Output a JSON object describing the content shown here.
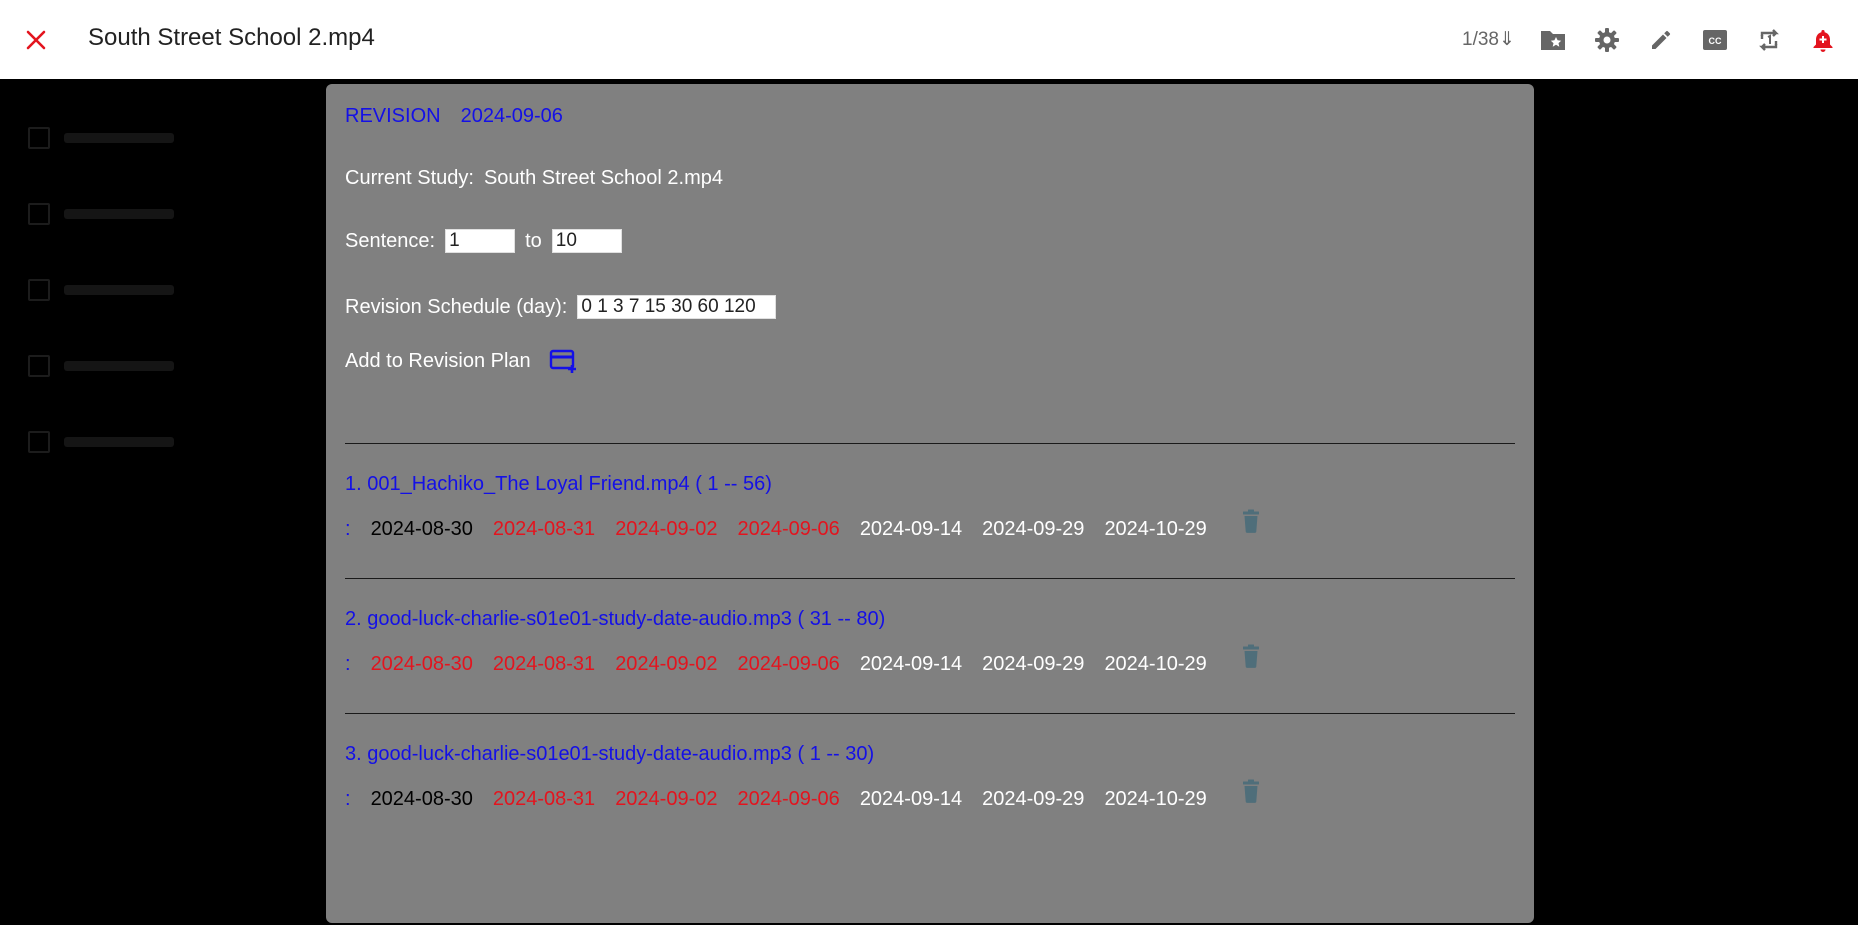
{
  "header": {
    "title": "South Street School 2.mp4",
    "counter": "1/38⇓",
    "icons": [
      "folder-star-icon",
      "gear-icon",
      "pencil-icon",
      "closed-caption-icon",
      "repeat-one-icon",
      "alarm-add-icon"
    ]
  },
  "panel": {
    "revision_label": "REVISION",
    "revision_date": "2024-09-06",
    "current_study_label": "Current Study:",
    "current_study_value": "South Street School 2.mp4",
    "sentence_label": "Sentence:",
    "sentence_from": "1",
    "sentence_to_label": "to",
    "sentence_to": "10",
    "schedule_label": "Revision Schedule (day):",
    "schedule_value": "0 1 3 7 15 30 60 120",
    "add_plan_label": "Add to Revision Plan"
  },
  "entries": [
    {
      "name": "1. 001_Hachiko_The Loyal Friend.mp4 ( 1 -- 56) :",
      "dates": [
        {
          "date": "2024-08-30",
          "status": "black"
        },
        {
          "date": "2024-08-31",
          "status": "red"
        },
        {
          "date": "2024-09-02",
          "status": "red"
        },
        {
          "date": "2024-09-06",
          "status": "red"
        },
        {
          "date": "2024-09-14",
          "status": "white"
        },
        {
          "date": "2024-09-29",
          "status": "white"
        },
        {
          "date": "2024-10-29",
          "status": "white"
        }
      ]
    },
    {
      "name": "2. good-luck-charlie-s01e01-study-date-audio.mp3 ( 31 -- 80) :",
      "dates": [
        {
          "date": "2024-08-30",
          "status": "red"
        },
        {
          "date": "2024-08-31",
          "status": "red"
        },
        {
          "date": "2024-09-02",
          "status": "red"
        },
        {
          "date": "2024-09-06",
          "status": "red"
        },
        {
          "date": "2024-09-14",
          "status": "white"
        },
        {
          "date": "2024-09-29",
          "status": "white"
        },
        {
          "date": "2024-10-29",
          "status": "white"
        }
      ]
    },
    {
      "name": "3. good-luck-charlie-s01e01-study-date-audio.mp3 ( 1 -- 30) :",
      "dates": [
        {
          "date": "2024-08-30",
          "status": "black"
        },
        {
          "date": "2024-08-31",
          "status": "red"
        },
        {
          "date": "2024-09-02",
          "status": "red"
        },
        {
          "date": "2024-09-06",
          "status": "red"
        },
        {
          "date": "2024-09-14",
          "status": "white"
        },
        {
          "date": "2024-09-29",
          "status": "white"
        },
        {
          "date": "2024-10-29",
          "status": "white"
        }
      ]
    }
  ],
  "colors": {
    "accent_blue": "#1410e6",
    "due_red": "#e3141e",
    "alert_red": "#e3141e",
    "panel_bg": "#808080",
    "trash_icon": "#4f6e7a"
  }
}
